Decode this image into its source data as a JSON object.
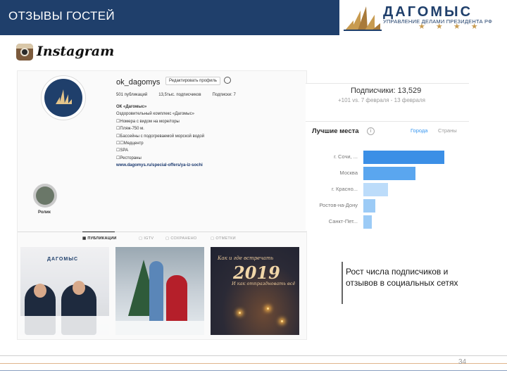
{
  "header": {
    "title": "ОТЗЫВЫ ГОСТЕЙ"
  },
  "logo": {
    "name": "ДАГОМЫС",
    "subtitle": "УПРАВЛЕНИЕ ДЕЛАМИ ПРЕЗИДЕНТА РФ",
    "stars": "★ ★ ★ ★"
  },
  "instagram": {
    "wordmark": "Instagram"
  },
  "profile": {
    "username": "ok_dagomys",
    "edit_button": "Редактировать профиль",
    "stats": [
      "501 публикаций",
      "13,5тыс. подписчиков",
      "Подписки: 7"
    ],
    "bio": {
      "name": "ОК «Дагомыс»",
      "lines": [
        "Оздоровительный комплекс «Дагомыс»",
        "☐Номера с видом на море/горы",
        "☐Пляж-750 м.",
        "☐Бассейны с подогреваемой морской водой",
        "☐☐Медцентр",
        "☐SPA",
        "☐Рестораны"
      ],
      "link": "www.dagomys.ru/special-offers/ya-iz-sochi"
    },
    "highlight_label": "Ролик",
    "tabs": [
      "ПУБЛИКАЦИИ",
      "IGTV",
      "СОХРАНЕНО",
      "ОТМЕТКИ"
    ],
    "posts": {
      "banner": "ДАГОМЫС",
      "p3_title": "Как и где встречать",
      "p3_year": "2019",
      "p3_sub": "И как отпраздновать всё"
    }
  },
  "stats_panel": {
    "title": "Подписчики: 13,529",
    "subtitle": "+101 vs. 7 февраля - 13 февраля",
    "top_places": "Лучшие места",
    "tab_cities": "Города",
    "tab_countries": "Страны"
  },
  "chart_data": {
    "type": "bar",
    "orientation": "horizontal",
    "categories": [
      "г. Сочи, ...",
      "Москва",
      "г. Красно...",
      "Ростов-на-Дону",
      "Санкт-Пет..."
    ],
    "values": [
      100,
      64,
      30,
      15,
      10
    ],
    "colors": [
      "#3b8fe6",
      "#5aa6ef",
      "#bcdcfa",
      "#9ccbf6",
      "#9ccbf6"
    ]
  },
  "note": {
    "text": "Рост числа подписчиков и отзывов в социальных сетях"
  },
  "footer": {
    "page_number": "34"
  }
}
